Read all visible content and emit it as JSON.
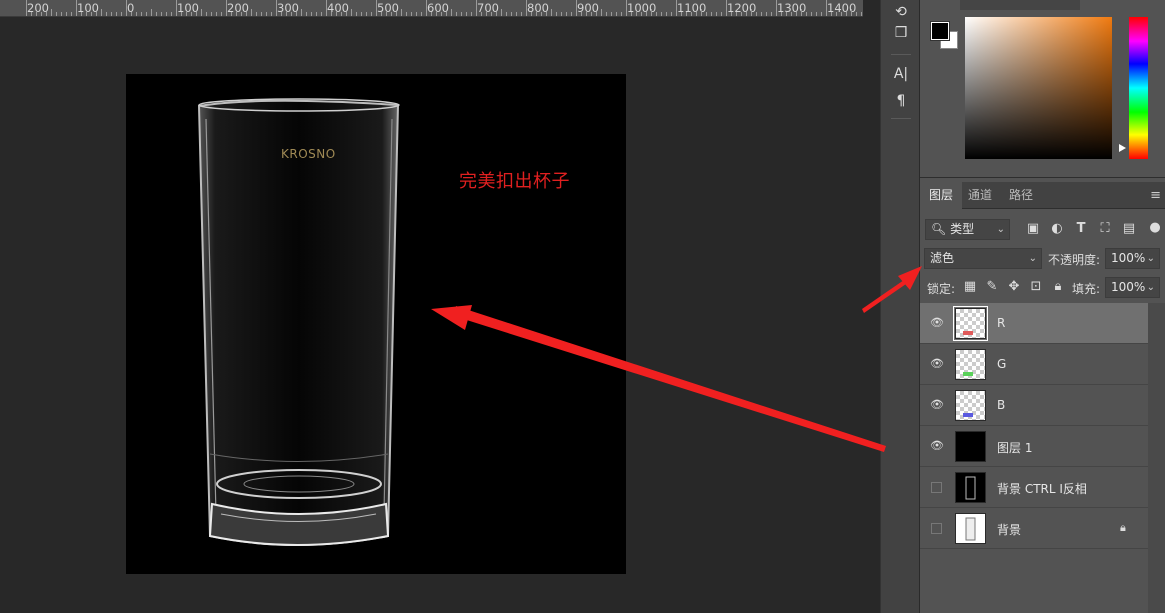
{
  "ruler": {
    "labels": [
      "200",
      "100",
      "0",
      "100",
      "200",
      "300",
      "400",
      "500",
      "600",
      "700",
      "800",
      "900",
      "1000",
      "1100",
      "1200",
      "1300",
      "1400"
    ]
  },
  "canvas": {
    "annotation": "完美扣出杯子",
    "brand_text": "KROSNO",
    "annotation_color": "#e02020",
    "arrow_color": "#f02020"
  },
  "tools": [
    {
      "icon": "history-brush-icon",
      "glyph": "⟲"
    },
    {
      "icon": "3d-object-icon",
      "glyph": "❒"
    },
    {
      "icon": "character-icon",
      "glyph": "A|"
    },
    {
      "icon": "paragraph-icon",
      "glyph": "¶"
    }
  ],
  "color_panel": {
    "foreground": "#000000",
    "background": "#ffffff",
    "hue_color": "#f07a10"
  },
  "layers_panel": {
    "tabs": [
      "图层",
      "通道",
      "路径"
    ],
    "active_tab": "图层",
    "filter_kind": "类型",
    "blend_mode": "滤色",
    "opacity_label": "不透明度:",
    "opacity_value": "100%",
    "lock_label": "锁定:",
    "fill_label": "填充:",
    "fill_value": "100%",
    "layers": [
      {
        "name": "R",
        "visible": true,
        "thumb": "trans",
        "tint": "#e05a5a",
        "selected": true,
        "locked": false
      },
      {
        "name": "G",
        "visible": true,
        "thumb": "trans",
        "tint": "#5ad25a",
        "selected": false,
        "locked": false
      },
      {
        "name": "B",
        "visible": true,
        "thumb": "trans",
        "tint": "#5a5ae0",
        "selected": false,
        "locked": false
      },
      {
        "name": "图层 1",
        "visible": true,
        "thumb": "black",
        "tint": "",
        "selected": false,
        "locked": false
      },
      {
        "name": "背景 CTRL I反相",
        "visible": false,
        "thumb": "black",
        "tint": "",
        "selected": false,
        "locked": false
      },
      {
        "name": "背景",
        "visible": false,
        "thumb": "white",
        "tint": "",
        "selected": false,
        "locked": true
      }
    ]
  }
}
